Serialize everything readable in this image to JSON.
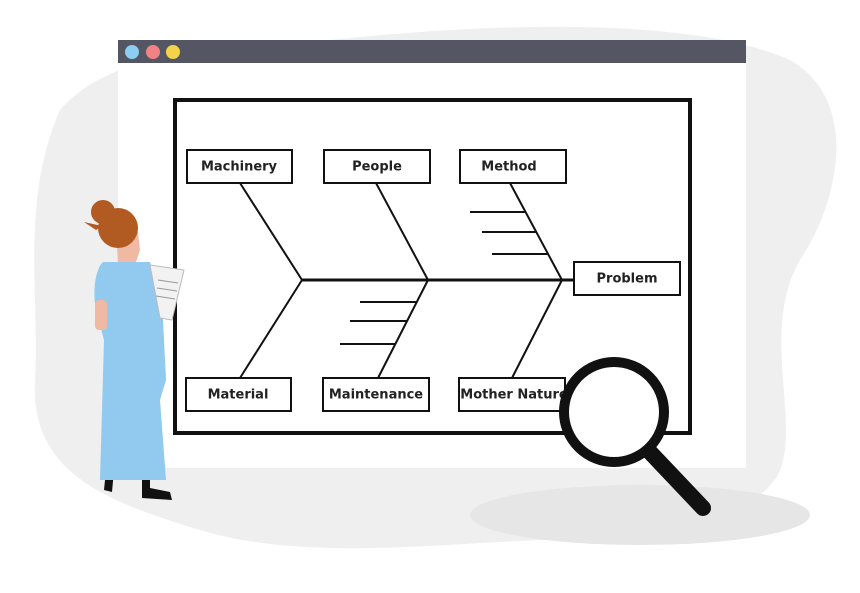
{
  "window": {
    "controls": [
      {
        "name": "close-dot",
        "color": "#8ecdf2"
      },
      {
        "name": "minimize-dot",
        "color": "#f08284"
      },
      {
        "name": "maximize-dot",
        "color": "#f4d34a"
      }
    ],
    "titlebar_color": "#555663"
  },
  "diagram": {
    "type": "fishbone",
    "effect": "Problem",
    "causes_top": [
      "Machinery",
      "People",
      "Method"
    ],
    "causes_bottom": [
      "Material",
      "Maintenance",
      "Mother Nature"
    ]
  },
  "colors": {
    "background_blob": "#efefef",
    "figure_dress": "#92c9ee",
    "figure_hair": "#b15b23"
  }
}
